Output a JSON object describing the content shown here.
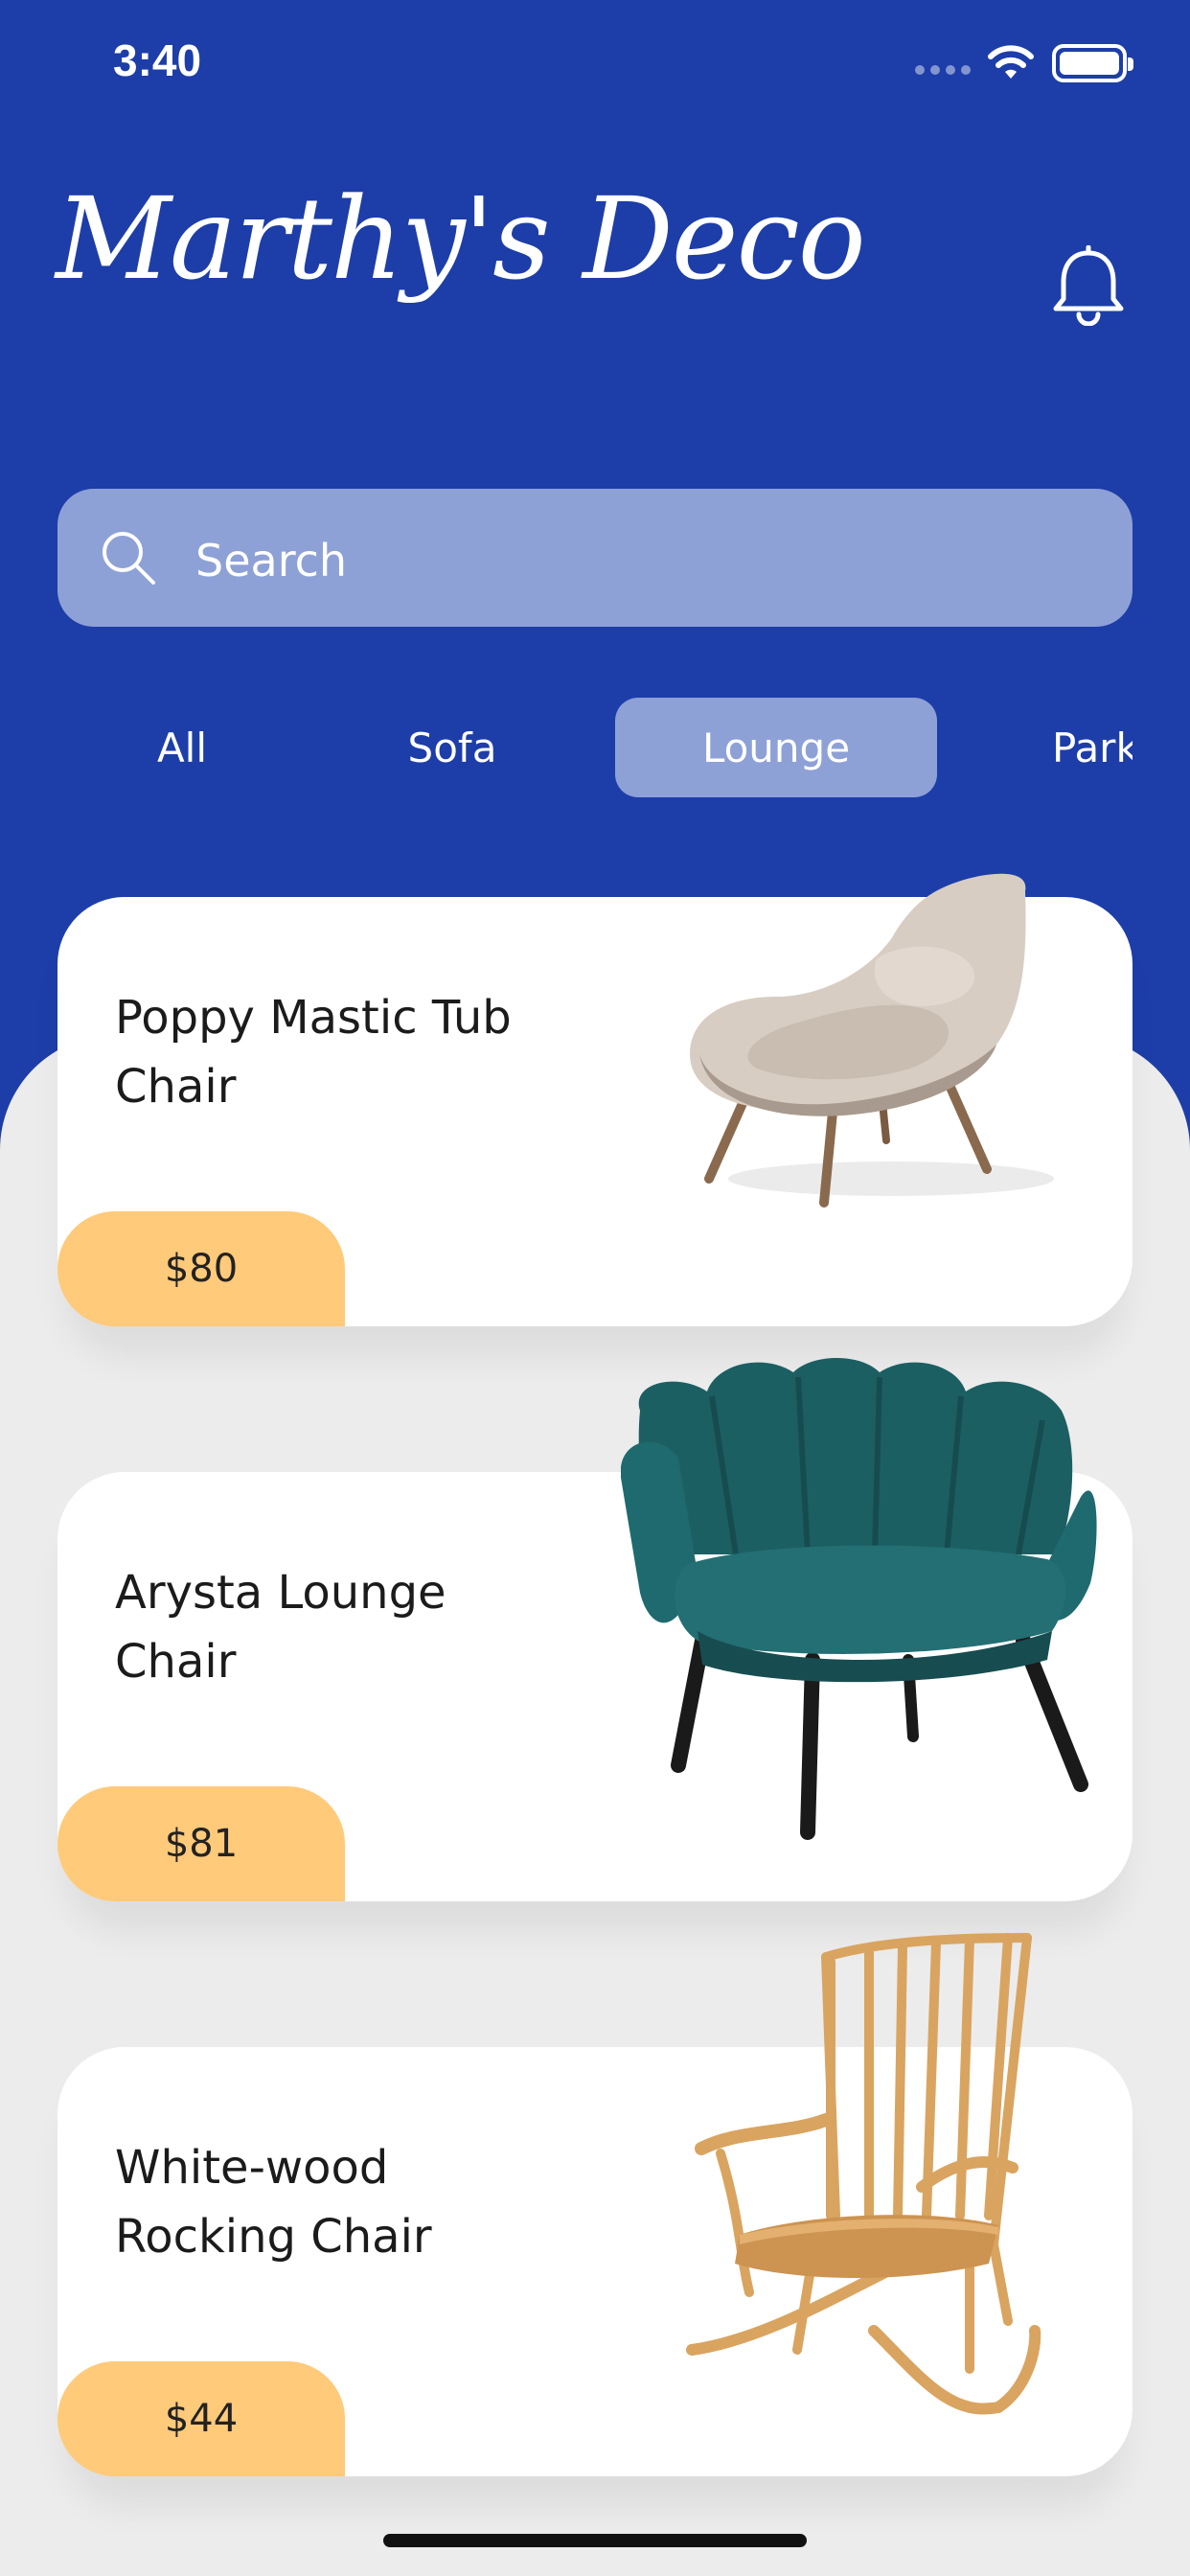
{
  "status_bar": {
    "time": "3:40"
  },
  "header": {
    "logo_text": "Marthy's Deco"
  },
  "search": {
    "placeholder": "Search"
  },
  "categories": [
    {
      "label": "All",
      "active": false
    },
    {
      "label": "Sofa",
      "active": false
    },
    {
      "label": "Lounge",
      "active": true
    },
    {
      "label": "Park",
      "active": false
    }
  ],
  "products": [
    {
      "title": "Poppy Mastic Tub Chair",
      "price": "$80",
      "image": "beige-tub-armchair"
    },
    {
      "title": "Arysta Lounge Chair",
      "price": "$81",
      "image": "teal-velvet-shell-chair"
    },
    {
      "title": "White-wood Rocking Chair",
      "price": "$44",
      "image": "wooden-rocking-chair"
    }
  ],
  "colors": {
    "primary": "#1d3ea8",
    "accent_pill": "#8ea1d6",
    "price_tag": "#ffca7a",
    "background": "#ececec"
  }
}
